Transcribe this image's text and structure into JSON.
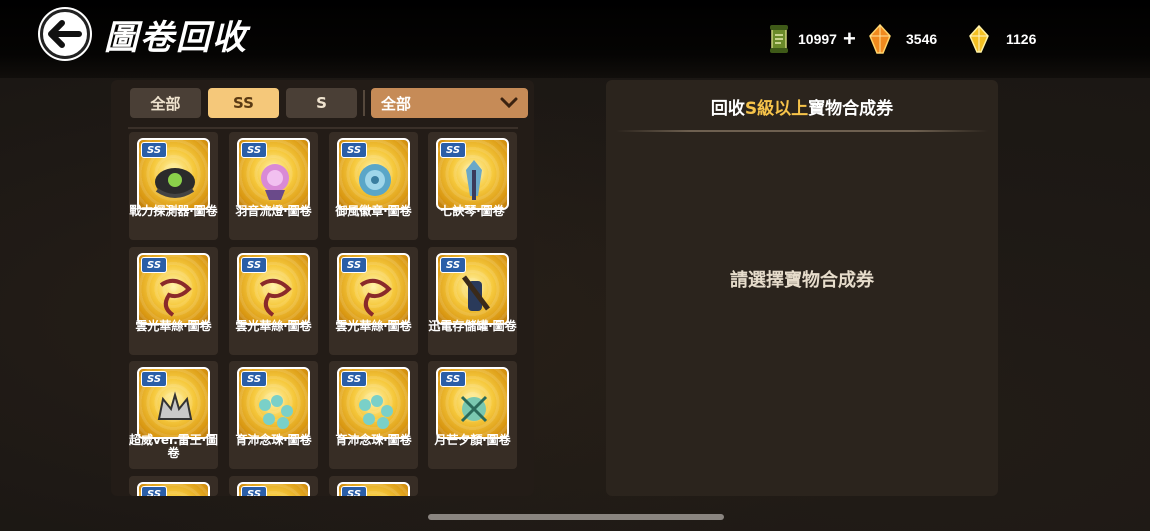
{
  "header": {
    "title": "圖卷回收",
    "currencies": [
      {
        "icon": "green-scroll-icon",
        "value": "10997",
        "has_plus": true
      },
      {
        "icon": "orange-crystal-icon",
        "value": "3546",
        "has_plus": false
      },
      {
        "icon": "gold-crystal-icon",
        "value": "1126",
        "has_plus": false
      }
    ]
  },
  "filters": {
    "tabs": [
      {
        "label": "全部",
        "active": false
      },
      {
        "label": "SS",
        "active": true
      },
      {
        "label": "S",
        "active": false
      }
    ],
    "dropdown_value": "全部"
  },
  "items": [
    {
      "badge": "SS",
      "name": "戰力探測器‧圖卷",
      "art": "scouter"
    },
    {
      "badge": "SS",
      "name": "羽音流燈‧圖卷",
      "art": "lantern"
    },
    {
      "badge": "SS",
      "name": "御風徽章‧圖卷",
      "art": "rose"
    },
    {
      "badge": "SS",
      "name": "七訣琴‧圖卷",
      "art": "axe"
    },
    {
      "badge": "SS",
      "name": "雲光華絲‧圖卷",
      "art": "ribbon"
    },
    {
      "badge": "SS",
      "name": "雲光華絲‧圖卷",
      "art": "ribbon"
    },
    {
      "badge": "SS",
      "name": "雲光華絲‧圖卷",
      "art": "ribbon"
    },
    {
      "badge": "SS",
      "name": "迅電存儲罐‧圖卷",
      "art": "vial"
    },
    {
      "badge": "SS",
      "name": "超威ver.雷王‧圖卷",
      "art": "crown"
    },
    {
      "badge": "SS",
      "name": "育沛念珠‧圖卷",
      "art": "beads"
    },
    {
      "badge": "SS",
      "name": "育沛念珠‧圖卷",
      "art": "beads"
    },
    {
      "badge": "SS",
      "name": "月芒夕顏‧圖卷",
      "art": "flower"
    },
    {
      "badge": "SS",
      "name": "",
      "art": "partial"
    },
    {
      "badge": "SS",
      "name": "",
      "art": "partial"
    },
    {
      "badge": "SS",
      "name": "",
      "art": "partial"
    }
  ],
  "right_panel": {
    "title_prefix": "回收",
    "title_highlight": "S級以上",
    "title_suffix": "寶物合成券",
    "hint": "請選擇寶物合成券"
  },
  "colors": {
    "accent_gold": "#f6c34a",
    "active_tab": "#f5c87a",
    "dropdown": "#c68b57",
    "badge_blue": "#2a5ea8"
  }
}
